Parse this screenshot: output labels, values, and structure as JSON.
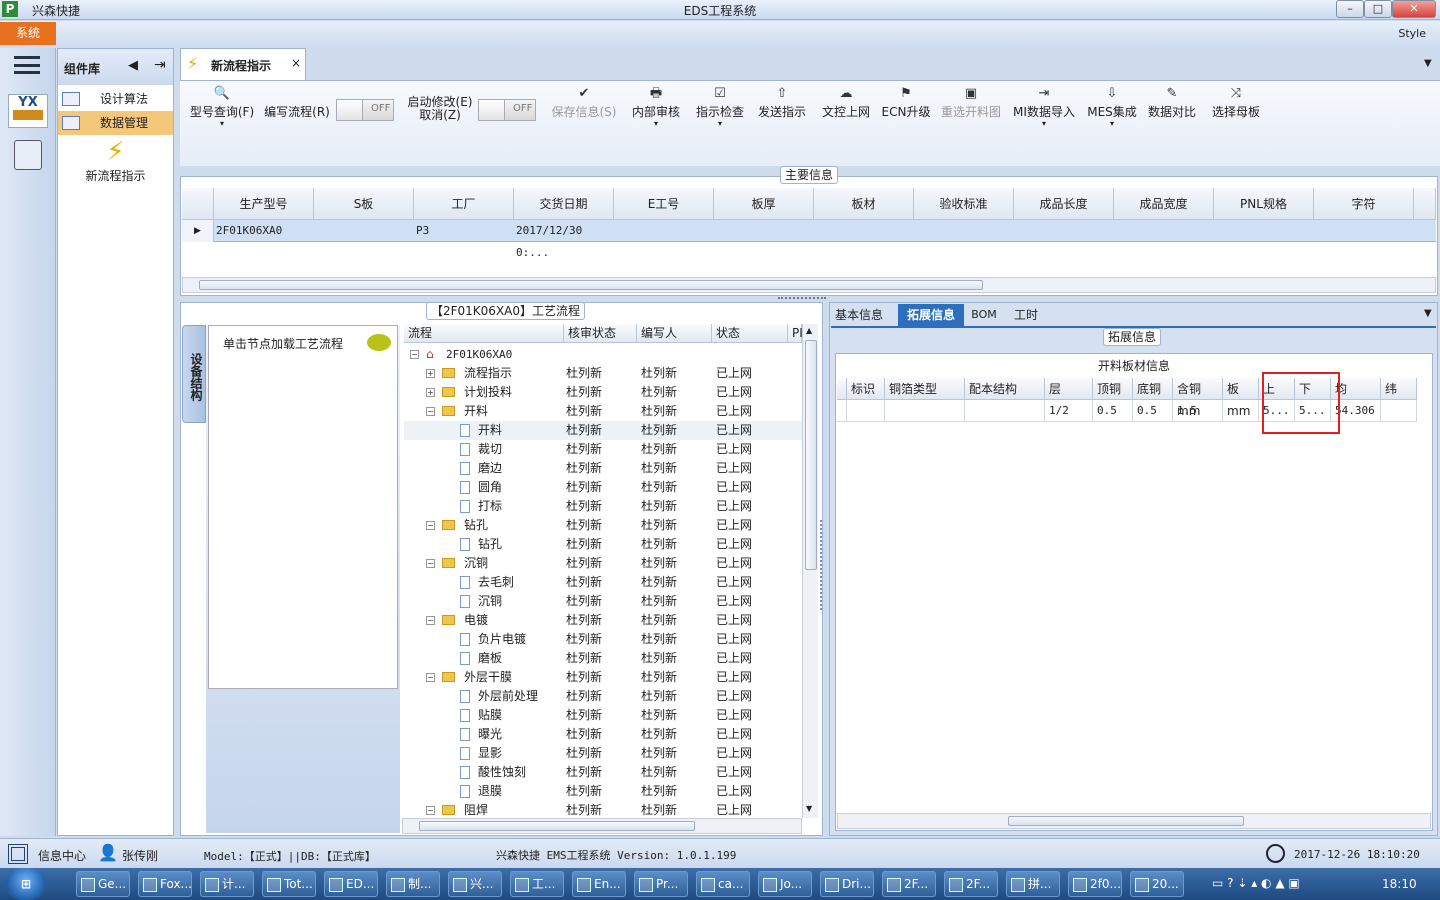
{
  "window": {
    "title": "EDS工程系统",
    "app_name": "兴森快捷",
    "logo_letter": "P",
    "min": "–",
    "max": "□",
    "close": "✕"
  },
  "menubar": {
    "system": "系统",
    "style": "Style"
  },
  "left_panel": {
    "title": "组件库",
    "items": [
      {
        "label": "设计算法"
      },
      {
        "label": "数据管理"
      }
    ],
    "big_item": "新流程指示"
  },
  "doc_tab": {
    "label": "新流程指示",
    "close": "×"
  },
  "toolbar": {
    "items": [
      {
        "label": "型号查询(F)",
        "icon": "🔍",
        "disabled": false
      },
      {
        "label": "编写流程(R)",
        "icon": "",
        "disabled": false
      },
      {
        "label": "启动修改(E)\n取消(Z)",
        "icon": "",
        "disabled": false
      },
      {
        "label": "保存信息(S)",
        "icon": "✔",
        "disabled": true
      },
      {
        "label": "内部审核",
        "icon": "🖶",
        "disabled": false
      },
      {
        "label": "指示检查",
        "icon": "☑",
        "disabled": false
      },
      {
        "label": "发送指示",
        "icon": "⇧",
        "disabled": false
      },
      {
        "label": "文控上网",
        "icon": "☁",
        "disabled": false
      },
      {
        "label": "ECN升级",
        "icon": "⚑",
        "disabled": false
      },
      {
        "label": "重选开料图",
        "icon": "▣",
        "disabled": true
      },
      {
        "label": "MI数据导入",
        "icon": "⇥",
        "disabled": false
      },
      {
        "label": "MES集成",
        "icon": "⇩",
        "disabled": false
      },
      {
        "label": "数据对比",
        "icon": "✎",
        "disabled": false
      },
      {
        "label": "选择母板",
        "icon": "⤨",
        "disabled": false
      }
    ],
    "toggle1": "OFF",
    "toggle2": "OFF"
  },
  "main_info": {
    "title": "主要信息",
    "columns": [
      "生产型号",
      "S板",
      "工厂",
      "交货日期",
      "E工号",
      "板厚",
      "板材",
      "验收标准",
      "成品长度",
      "成品宽度",
      "PNL规格",
      "字符"
    ],
    "row": [
      "2F01K06XA0",
      "",
      "P3",
      "2017/12/30 0:...",
      "",
      "",
      "",
      "",
      "",
      "",
      "",
      ""
    ]
  },
  "process": {
    "title": "【2F01K06XA0】工艺流程",
    "vertical_tab": "设备结构",
    "node_hint": "单击节点加载工艺流程",
    "columns": [
      "流程",
      "核审状态",
      "编写人",
      "状态",
      "PI"
    ],
    "root": "2F01K06XA0",
    "rows": [
      {
        "name": "流程指示",
        "type": "folder",
        "level": 1,
        "reviewer": "杜列新",
        "writer": "杜列新",
        "status": "已上网"
      },
      {
        "name": "计划投料",
        "type": "folder",
        "level": 1,
        "reviewer": "杜列新",
        "writer": "杜列新",
        "status": "已上网"
      },
      {
        "name": "开料",
        "type": "folder",
        "level": 1,
        "reviewer": "杜列新",
        "writer": "杜列新",
        "status": "已上网"
      },
      {
        "name": "开料",
        "type": "doc",
        "level": 2,
        "reviewer": "杜列新",
        "writer": "杜列新",
        "status": "已上网"
      },
      {
        "name": "裁切",
        "type": "doc",
        "level": 2,
        "reviewer": "杜列新",
        "writer": "杜列新",
        "status": "已上网"
      },
      {
        "name": "磨边",
        "type": "doc",
        "level": 2,
        "reviewer": "杜列新",
        "writer": "杜列新",
        "status": "已上网"
      },
      {
        "name": "圆角",
        "type": "doc",
        "level": 2,
        "reviewer": "杜列新",
        "writer": "杜列新",
        "status": "已上网"
      },
      {
        "name": "打标",
        "type": "doc",
        "level": 2,
        "reviewer": "杜列新",
        "writer": "杜列新",
        "status": "已上网"
      },
      {
        "name": "钻孔",
        "type": "folder",
        "level": 1,
        "reviewer": "杜列新",
        "writer": "杜列新",
        "status": "已上网"
      },
      {
        "name": "钻孔",
        "type": "doc",
        "level": 2,
        "reviewer": "杜列新",
        "writer": "杜列新",
        "status": "已上网"
      },
      {
        "name": "沉铜",
        "type": "folder",
        "level": 1,
        "reviewer": "杜列新",
        "writer": "杜列新",
        "status": "已上网"
      },
      {
        "name": "去毛刺",
        "type": "doc",
        "level": 2,
        "reviewer": "杜列新",
        "writer": "杜列新",
        "status": "已上网"
      },
      {
        "name": "沉铜",
        "type": "doc",
        "level": 2,
        "reviewer": "杜列新",
        "writer": "杜列新",
        "status": "已上网"
      },
      {
        "name": "电镀",
        "type": "folder",
        "level": 1,
        "reviewer": "杜列新",
        "writer": "杜列新",
        "status": "已上网"
      },
      {
        "name": "负片电镀",
        "type": "doc",
        "level": 2,
        "reviewer": "杜列新",
        "writer": "杜列新",
        "status": "已上网"
      },
      {
        "name": "磨板",
        "type": "doc",
        "level": 2,
        "reviewer": "杜列新",
        "writer": "杜列新",
        "status": "已上网"
      },
      {
        "name": "外层干膜",
        "type": "folder",
        "level": 1,
        "reviewer": "杜列新",
        "writer": "杜列新",
        "status": "已上网"
      },
      {
        "name": "外层前处理",
        "type": "doc",
        "level": 2,
        "reviewer": "杜列新",
        "writer": "杜列新",
        "status": "已上网"
      },
      {
        "name": "贴膜",
        "type": "doc",
        "level": 2,
        "reviewer": "杜列新",
        "writer": "杜列新",
        "status": "已上网"
      },
      {
        "name": "曝光",
        "type": "doc",
        "level": 2,
        "reviewer": "杜列新",
        "writer": "杜列新",
        "status": "已上网"
      },
      {
        "name": "显影",
        "type": "doc",
        "level": 2,
        "reviewer": "杜列新",
        "writer": "杜列新",
        "status": "已上网"
      },
      {
        "name": "酸性蚀刻",
        "type": "doc",
        "level": 2,
        "reviewer": "杜列新",
        "writer": "杜列新",
        "status": "已上网"
      },
      {
        "name": "退膜",
        "type": "doc",
        "level": 2,
        "reviewer": "杜列新",
        "writer": "杜列新",
        "status": "已上网"
      },
      {
        "name": "阻焊",
        "type": "folder",
        "level": 1,
        "reviewer": "杜列新",
        "writer": "杜列新",
        "status": "已上网"
      }
    ]
  },
  "right_tabs": [
    "基本信息",
    "拓展信息",
    "BOM",
    "工时"
  ],
  "ext_info": {
    "group": "拓展信息",
    "table_title": "开料板材信息",
    "columns": [
      "标识",
      "铜箔类型",
      "配本结构",
      "层",
      "顶铜",
      "底铜",
      "含铜mm",
      "板mm",
      "上",
      "下",
      "均",
      "纬"
    ],
    "row": [
      "",
      "",
      "",
      "1/2",
      "0.5",
      "0.5",
      "1.5",
      "",
      "5...",
      "5...",
      "54.306",
      ""
    ]
  },
  "statusbar": {
    "info_center": "信息中心",
    "user": "张传刚",
    "model": "Model:【正式】||DB:【正式库】",
    "version": "兴森快捷 EMS工程系统 Version: 1.0.1.199",
    "datetime": "2017-12-26 18:10:20"
  },
  "taskbar": {
    "items": [
      "Ge...",
      "Fox...",
      "计...",
      "Tot...",
      "ED...",
      "制...",
      "兴...",
      "工...",
      "En...",
      "Pr...",
      "ca...",
      "Jo...",
      "Dri...",
      "2F...",
      "2F...",
      "拼...",
      "2f0...",
      "20..."
    ],
    "clock": "18:10"
  }
}
